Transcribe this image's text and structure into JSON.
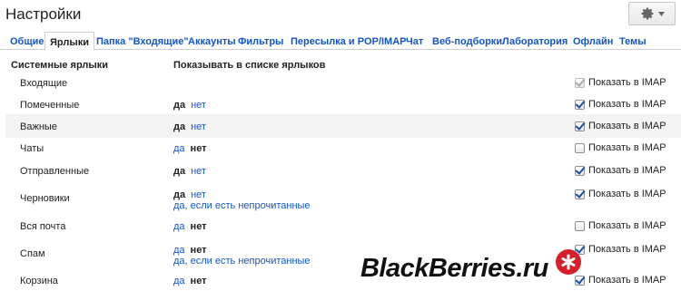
{
  "header": {
    "title": "Настройки"
  },
  "tabs": [
    {
      "label": "Общие",
      "active": false
    },
    {
      "label": "Ярлыки",
      "active": true
    },
    {
      "label": "Папка \"Входящие\"",
      "active": false
    },
    {
      "label": "Аккаунты",
      "active": false
    },
    {
      "label": "Фильтры",
      "active": false
    },
    {
      "label": "Пересылка и POP/IMAP",
      "active": false
    },
    {
      "label": "Чат",
      "active": false
    },
    {
      "label": "Веб-подборки",
      "active": false
    },
    {
      "label": "Лаборатория",
      "active": false
    },
    {
      "label": "Офлайн",
      "active": false
    },
    {
      "label": "Темы",
      "active": false
    }
  ],
  "section": {
    "system_labels_header": "Системные ярлыки",
    "show_in_list_header": "Показывать в списке ярлыков"
  },
  "imap_label": "Показать в IMAP",
  "rows": [
    {
      "name": "Входящие",
      "options": [],
      "extra_option": null,
      "imap_checked": true,
      "imap_disabled": true
    },
    {
      "name": "Помеченные",
      "options": [
        "да",
        "нет"
      ],
      "selected": "да",
      "extra_option": null,
      "imap_checked": true,
      "imap_disabled": false
    },
    {
      "name": "Важные",
      "options": [
        "да",
        "нет"
      ],
      "selected": "да",
      "extra_option": null,
      "imap_checked": true,
      "imap_disabled": false
    },
    {
      "name": "Чаты",
      "options": [
        "да",
        "нет"
      ],
      "selected": "нет",
      "extra_option": null,
      "imap_checked": false,
      "imap_disabled": false
    },
    {
      "name": "Отправленные",
      "options": [
        "да",
        "нет"
      ],
      "selected": "да",
      "extra_option": null,
      "imap_checked": true,
      "imap_disabled": false
    },
    {
      "name": "Черновики",
      "options": [
        "да",
        "нет"
      ],
      "selected": "да",
      "extra_option": "да, если есть непрочитанные",
      "imap_checked": true,
      "imap_disabled": false
    },
    {
      "name": "Вся почта",
      "options": [
        "да",
        "нет"
      ],
      "selected": "нет",
      "extra_option": null,
      "imap_checked": false,
      "imap_disabled": false
    },
    {
      "name": "Спам",
      "options": [
        "да",
        "нет"
      ],
      "selected": "нет",
      "extra_option": "да, если есть непрочитанные",
      "imap_checked": true,
      "imap_disabled": false
    },
    {
      "name": "Корзина",
      "options": [
        "да",
        "нет"
      ],
      "selected": "нет",
      "extra_option": null,
      "imap_checked": true,
      "imap_disabled": false
    }
  ],
  "watermark": {
    "text": "BlackBerries.ru"
  },
  "colors": {
    "link": "#1155cc",
    "text": "#222222",
    "alt_row": "#f3f3f3",
    "watermark_dot": "#d61f2b"
  }
}
